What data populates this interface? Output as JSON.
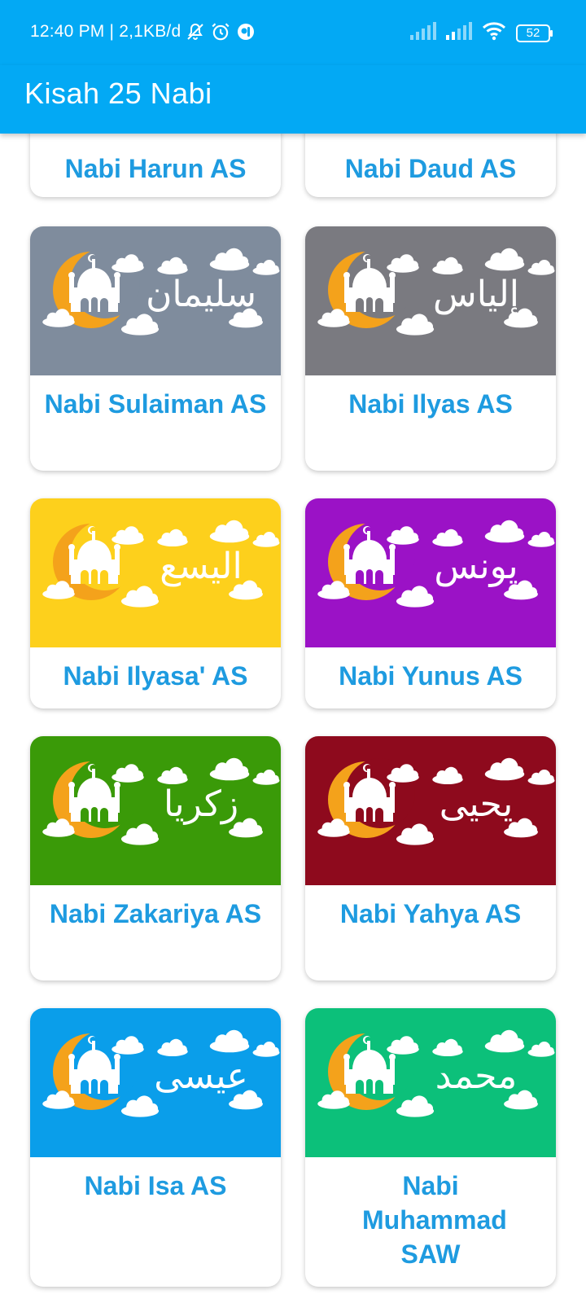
{
  "status_bar": {
    "time_speed": "12:40 PM | 2,1KB/d",
    "battery": "52",
    "icons": [
      "bell-off-icon",
      "alarm-icon",
      "app-notification-icon",
      "signal-icon",
      "signal-icon-2",
      "wifi-icon",
      "battery-icon"
    ]
  },
  "app_bar": {
    "title": "Kisah 25 Nabi"
  },
  "cards": [
    {
      "label": "Nabi Harun AS",
      "arabic": "",
      "color": "#d32f2f"
    },
    {
      "label": "Nabi Daud AS",
      "arabic": "",
      "color": "#b0bec5"
    },
    {
      "label": "Nabi Sulaiman AS",
      "arabic": "سليمان",
      "color": "#7f8c9d"
    },
    {
      "label": "Nabi Ilyas AS",
      "arabic": "إلياس",
      "color": "#7a7a80"
    },
    {
      "label": "Nabi Ilyasa' AS",
      "arabic": "اليسع",
      "color": "#fdd01c"
    },
    {
      "label": "Nabi Yunus AS",
      "arabic": "يونس",
      "color": "#9b12c6"
    },
    {
      "label": "Nabi Zakariya AS",
      "arabic": "زكريا",
      "color": "#3a9a08"
    },
    {
      "label": "Nabi Yahya AS",
      "arabic": "يحيى",
      "color": "#8e0a1d"
    },
    {
      "label": "Nabi Isa AS",
      "arabic": "عيسى",
      "color": "#0a9eea"
    },
    {
      "label": "Nabi Muhammad SAW",
      "arabic": "محمد",
      "color": "#0cc07a"
    }
  ]
}
